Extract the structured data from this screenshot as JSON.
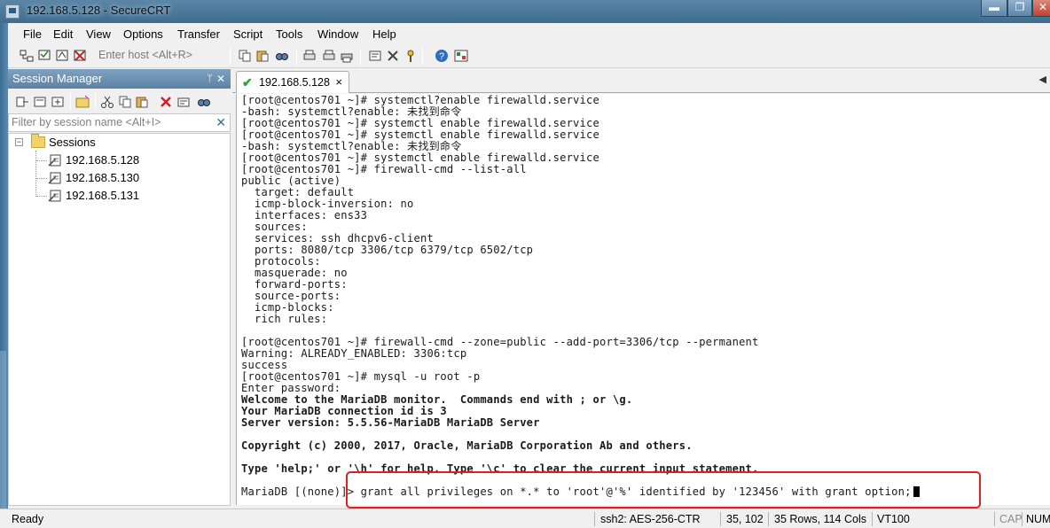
{
  "window": {
    "title": "192.168.5.128 - SecureCRT"
  },
  "menu": [
    "File",
    "Edit",
    "View",
    "Options",
    "Transfer",
    "Script",
    "Tools",
    "Window",
    "Help"
  ],
  "toolbar": {
    "host_placeholder": "Enter host <Alt+R>"
  },
  "session_manager": {
    "title": "Session Manager",
    "filter_placeholder": "Filter by session name <Alt+I>",
    "root": "Sessions",
    "sessions": [
      "192.168.5.128",
      "192.168.5.130",
      "192.168.5.131"
    ]
  },
  "tab": {
    "label": "192.168.5.128",
    "close": "×"
  },
  "terminal": {
    "lines": [
      "[root@centos701 ~]# systemctl?enable firewalld.service",
      "-bash: systemctl?enable: 未找到命令",
      "[root@centos701 ~]# systemctl enable firewalld.service",
      "[root@centos701 ~]# systemctl enable firewalld.service",
      "-bash: systemctl?enable: 未找到命令",
      "[root@centos701 ~]# systemctl enable firewalld.service",
      "[root@centos701 ~]# firewall-cmd --list-all",
      "public (active)",
      "  target: default",
      "  icmp-block-inversion: no",
      "  interfaces: ens33",
      "  sources:",
      "  services: ssh dhcpv6-client",
      "  ports: 8080/tcp 3306/tcp 6379/tcp 6502/tcp",
      "  protocols:",
      "  masquerade: no",
      "  forward-ports:",
      "  source-ports:",
      "  icmp-blocks:",
      "  rich rules:",
      "",
      "[root@centos701 ~]# firewall-cmd --zone=public --add-port=3306/tcp --permanent",
      "Warning: ALREADY_ENABLED: 3306:tcp",
      "success",
      "[root@centos701 ~]# mysql -u root -p",
      "Enter password:",
      "Welcome to the MariaDB monitor.  Commands end with ; or \\g.",
      "Your MariaDB connection id is 3",
      "Server version: 5.5.56-MariaDB MariaDB Server",
      "",
      "Copyright (c) 2000, 2017, Oracle, MariaDB Corporation Ab and others.",
      "",
      "Type 'help;' or '\\h' for help. Type '\\c' to clear the current input statement.",
      "",
      "MariaDB [(none)]> grant all privileges on *.* to 'root'@'%' identified by '123456' with grant option;"
    ],
    "bold_lines": [
      26,
      27,
      28,
      30,
      32
    ]
  },
  "status": {
    "ready": "Ready",
    "cipher": "ssh2: AES-256-CTR",
    "position": "35, 102",
    "size": "35 Rows, 114 Cols",
    "emulation": "VT100",
    "cap": "CAP",
    "num": "NUM"
  },
  "colors": {
    "accent": "#5b82a5",
    "highlight": "#e02020"
  }
}
